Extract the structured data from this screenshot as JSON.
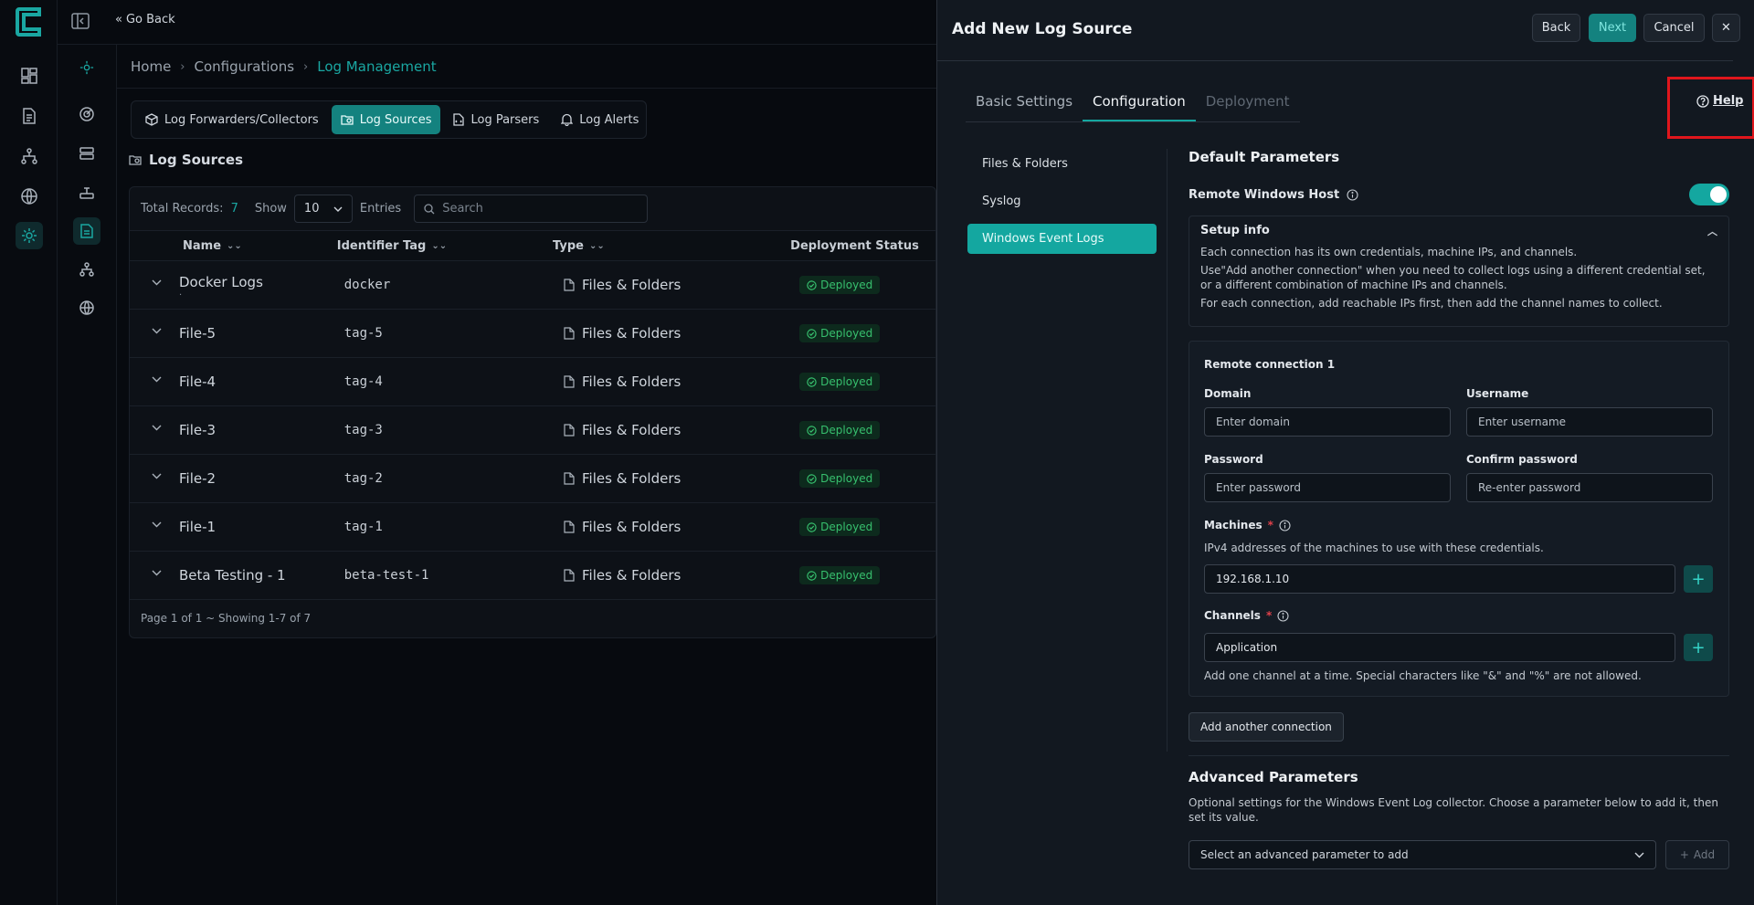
{
  "app": {
    "go_back": "Go Back",
    "logo_letter": "C"
  },
  "breadcrumb": [
    "Home",
    "Configurations",
    "Log Management"
  ],
  "tabs": [
    {
      "label": "Log Forwarders/Collectors",
      "icon": "box-icon"
    },
    {
      "label": "Log Sources",
      "icon": "folder-search-icon"
    },
    {
      "label": "Log Parsers",
      "icon": "file-code-icon"
    },
    {
      "label": "Log Alerts",
      "icon": "bell-icon"
    }
  ],
  "section_title": "Log Sources",
  "table": {
    "total_label": "Total Records:",
    "total_value": "7",
    "show_label": "Show",
    "show_value": "10",
    "entries_label": "Entries",
    "search_placeholder": "Search",
    "columns": [
      "Name",
      "Identifier Tag",
      "Type",
      "Deployment Status"
    ],
    "rows": [
      {
        "name": "Docker Logs",
        "sub": ".",
        "tag": "docker",
        "type": "Files & Folders",
        "status": "Deployed"
      },
      {
        "name": "File-5",
        "tag": "tag-5",
        "type": "Files & Folders",
        "status": "Deployed"
      },
      {
        "name": "File-4",
        "tag": "tag-4",
        "type": "Files & Folders",
        "status": "Deployed"
      },
      {
        "name": "File-3",
        "tag": "tag-3",
        "type": "Files & Folders",
        "status": "Deployed"
      },
      {
        "name": "File-2",
        "tag": "tag-2",
        "type": "Files & Folders",
        "status": "Deployed"
      },
      {
        "name": "File-1",
        "tag": "tag-1",
        "type": "Files & Folders",
        "status": "Deployed"
      },
      {
        "name": "Beta Testing - 1",
        "tag": "beta-test-1",
        "type": "Files & Folders",
        "status": "Deployed"
      }
    ],
    "footer": "Page 1 of 1 ~ Showing 1-7 of 7"
  },
  "drawer": {
    "title": "Add New Log Source",
    "back": "Back",
    "next": "Next",
    "cancel": "Cancel",
    "close": "✕",
    "tabs": [
      "Basic Settings",
      "Configuration",
      "Deployment"
    ],
    "help": "Help",
    "side_nav": [
      "Files & Folders",
      "Syslog",
      "Windows Event Logs"
    ],
    "default_params_title": "Default Parameters",
    "remote_windows_host": "Remote Windows Host",
    "setup_title": "Setup info",
    "setup_lines": [
      "Each connection has its own credentials, machine IPs, and channels.",
      "Use\"Add another connection\" when you need to collect logs using a different credential set, or a different combination of machine IPs and channels.",
      "For each connection, add reachable IPs first, then add the channel names to collect."
    ],
    "connection_title": "Remote connection 1",
    "domain_label": "Domain",
    "domain_placeholder": "Enter domain",
    "username_label": "Username",
    "username_placeholder": "Enter username",
    "password_label": "Password",
    "password_placeholder": "Enter password",
    "confirm_label": "Confirm password",
    "confirm_placeholder": "Re-enter password",
    "machines_label": "Machines",
    "machines_help": "IPv4 addresses of the machines to use with these credentials.",
    "machines_value": "192.168.1.10",
    "channels_label": "Channels",
    "channels_value": "Application",
    "channels_help": "Add one channel at a time. Special characters like \"&\" and \"%\" are not allowed.",
    "add_connection": "Add another connection",
    "advanced_title": "Advanced Parameters",
    "advanced_desc": "Optional settings for the Windows Event Log collector. Choose a parameter below to add it, then set its value.",
    "advanced_select": "Select an advanced parameter to add",
    "advanced_add": "Add",
    "required_mark": "*"
  },
  "colors": {
    "accent": "#14a7a0",
    "accent_dark": "#14827f",
    "status_green": "#37c06e",
    "highlight_red": "#e0161c"
  }
}
